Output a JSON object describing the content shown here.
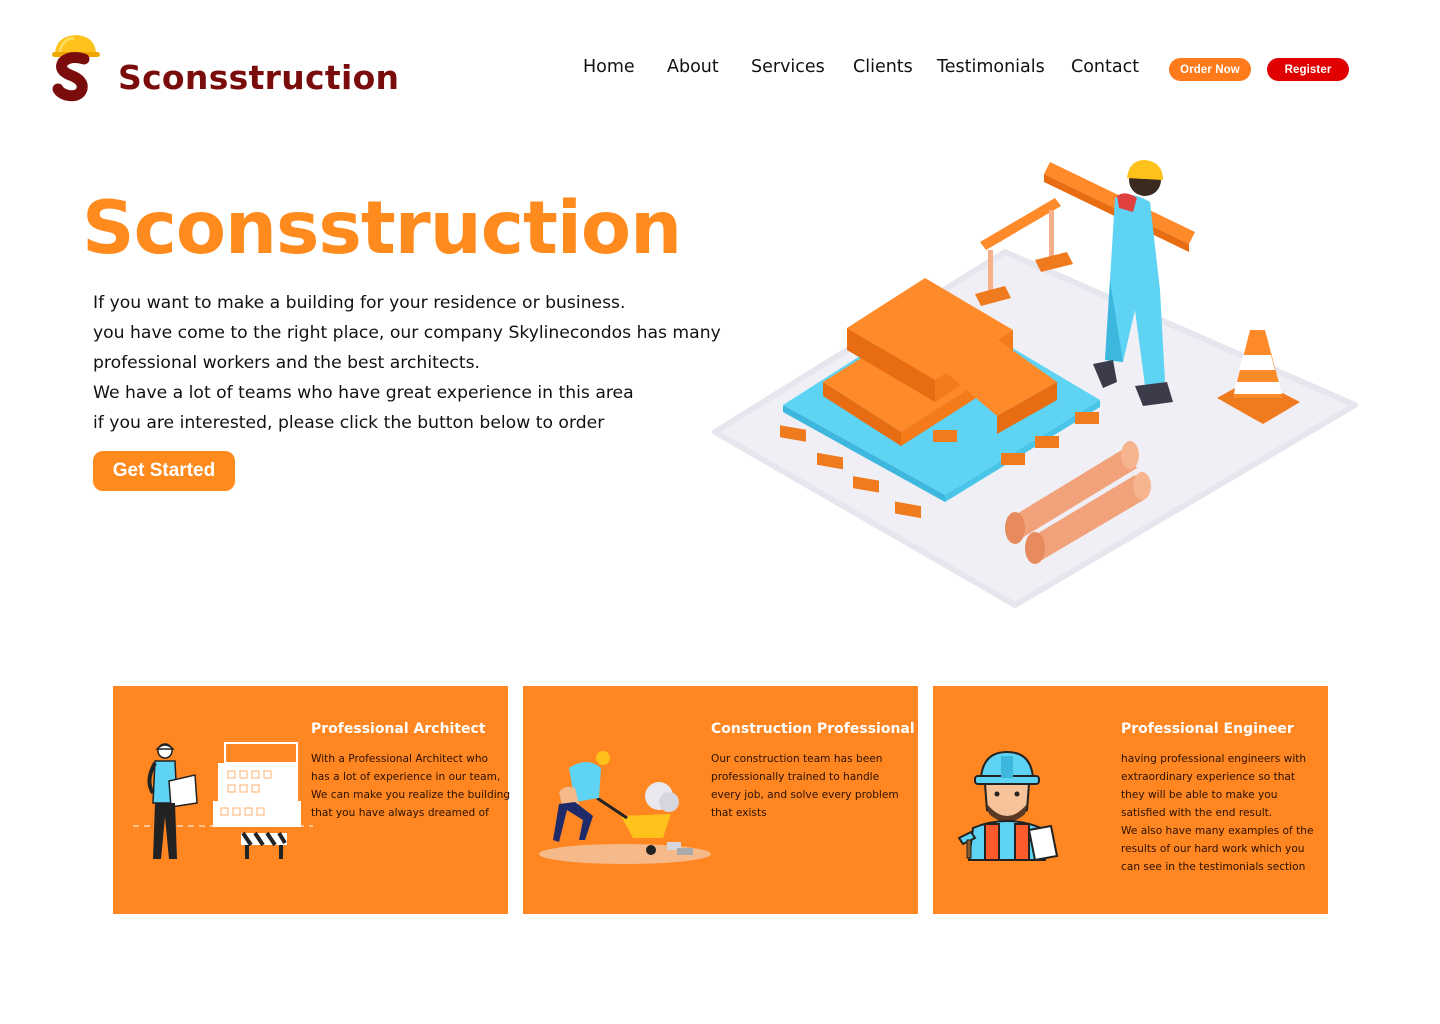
{
  "header": {
    "brand": "Sconsstruction",
    "nav": [
      "Home",
      "About",
      "Services",
      "Clients",
      "Testimonials",
      "Contact"
    ],
    "order_label": "Order Now",
    "register_label": "Register"
  },
  "hero": {
    "title": "Sconsstruction",
    "lines": [
      "If you want to make a building for your residence or business.",
      "you have come to the right place, our company Skylinecondos has many",
      "professional workers and the best architects.",
      "We have a lot of teams who have great experience in this area",
      "if you are interested, please click the button below to order"
    ],
    "cta_label": "Get Started"
  },
  "cards": [
    {
      "title": "Professional Architect",
      "lines": [
        "With a Professional Architect who",
        "has a lot of experience in our team,",
        "We can make you realize the building",
        "that you have always dreamed of"
      ]
    },
    {
      "title": "Construction Professional",
      "lines": [
        "Our construction team has been",
        "professionally trained to handle",
        "every job, and solve every problem",
        "that exists"
      ]
    },
    {
      "title": "Professional Engineer",
      "lines": [
        "having professional engineers with",
        "extraordinary experience so that",
        "they will be able to make you",
        "satisfied with the end result.",
        "We also have many examples of the",
        "results of our hard work which you",
        "can see in the testimonials section"
      ]
    }
  ],
  "colors": {
    "brand_dark": "#7a0c0c",
    "accent_orange": "#ff8a1e",
    "card_orange": "#ff8621",
    "register_red": "#e00000",
    "helmet_yellow": "#ffc21a",
    "plank_blue": "#5ed3f3"
  },
  "icons": [
    "helmet-s-logo-icon",
    "construction-site-illustration",
    "architect-illustration",
    "wheelbarrow-worker-illustration",
    "engineer-illustration"
  ]
}
